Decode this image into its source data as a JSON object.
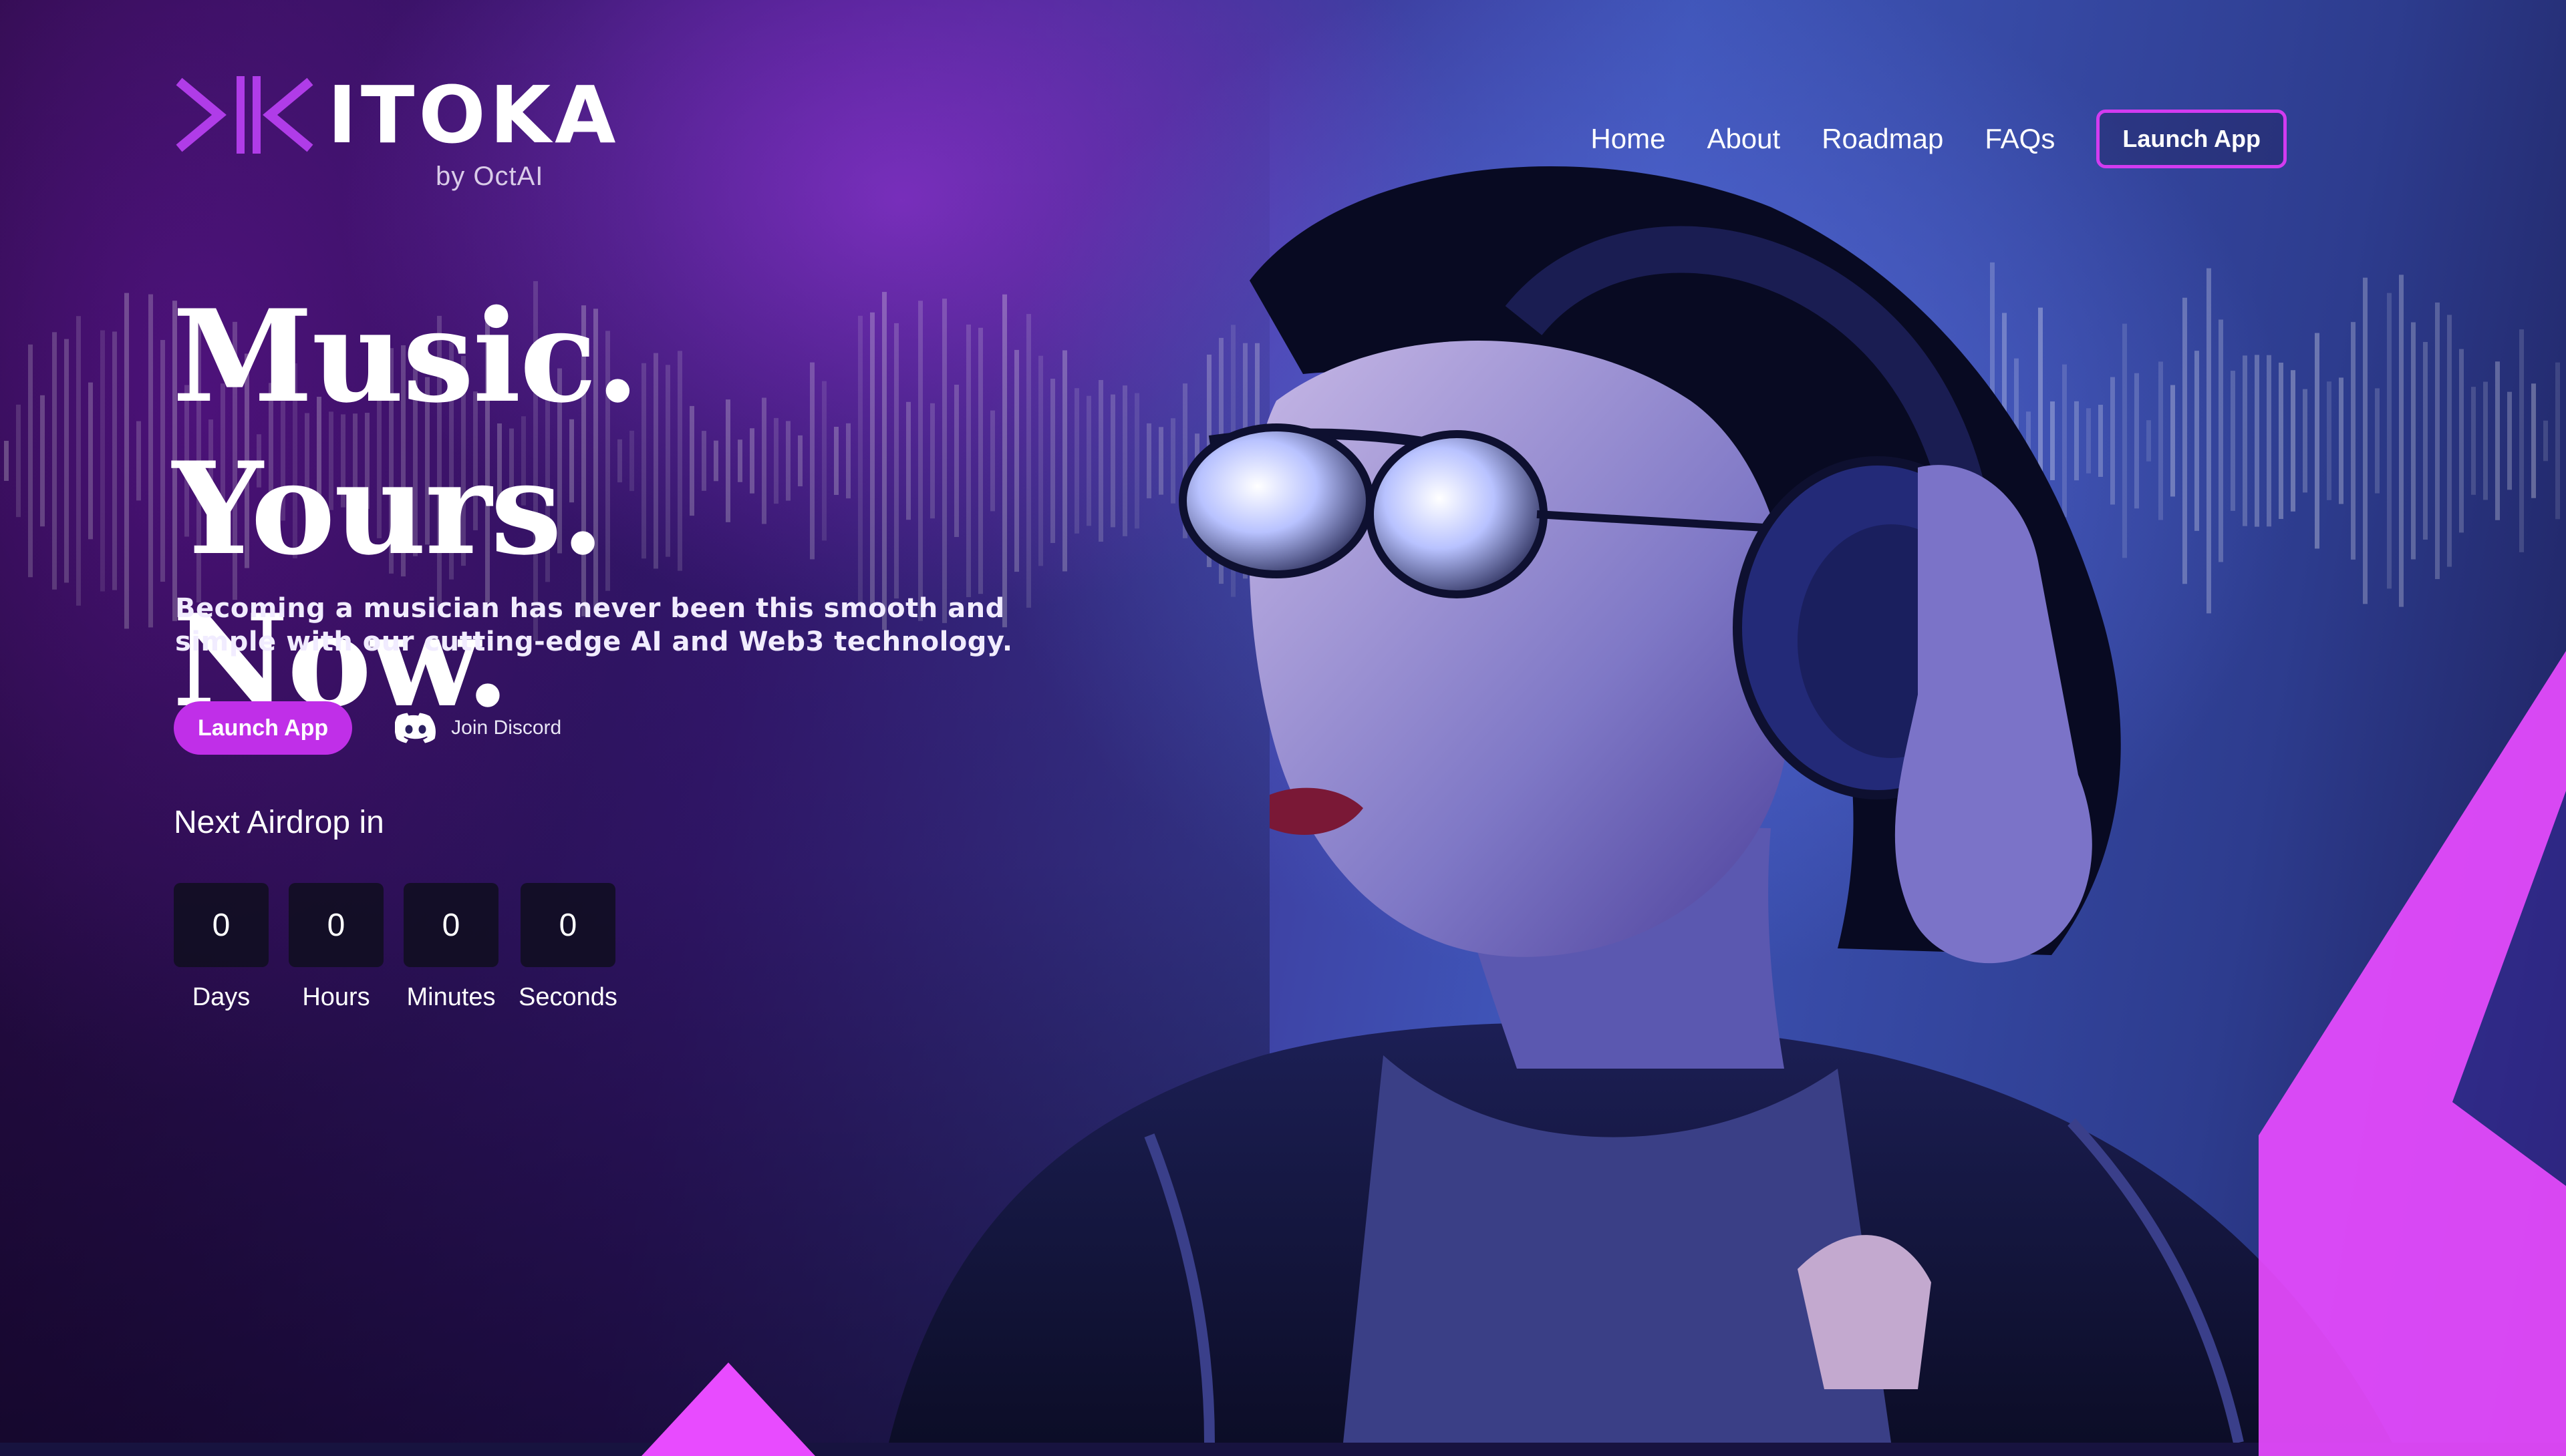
{
  "brand": {
    "name": "ITOKA",
    "byline": "by OctAI",
    "accent": "#c02fe8",
    "neon": "#e84bff"
  },
  "nav": {
    "items": [
      "Home",
      "About",
      "Roadmap",
      "FAQs"
    ],
    "cta": "Launch App"
  },
  "hero": {
    "title_line1": "Music. Yours.",
    "title_line2": "Now.",
    "subtitle": "Becoming a musician has never been this smooth and simple with our cutting-edge AI and Web3 technology.",
    "primary_cta": "Launch App",
    "secondary_cta": "Join Discord",
    "secondary_icon": "discord-icon"
  },
  "airdrop": {
    "title": "Next Airdrop in",
    "units": [
      {
        "value": "0",
        "label": "Days"
      },
      {
        "value": "0",
        "label": "Hours"
      },
      {
        "value": "0",
        "label": "Minutes"
      },
      {
        "value": "0",
        "label": "Seconds"
      }
    ]
  },
  "background": {
    "image": "woman-with-headphones-and-sunglasses",
    "decor": "audio-waveform-bars"
  }
}
